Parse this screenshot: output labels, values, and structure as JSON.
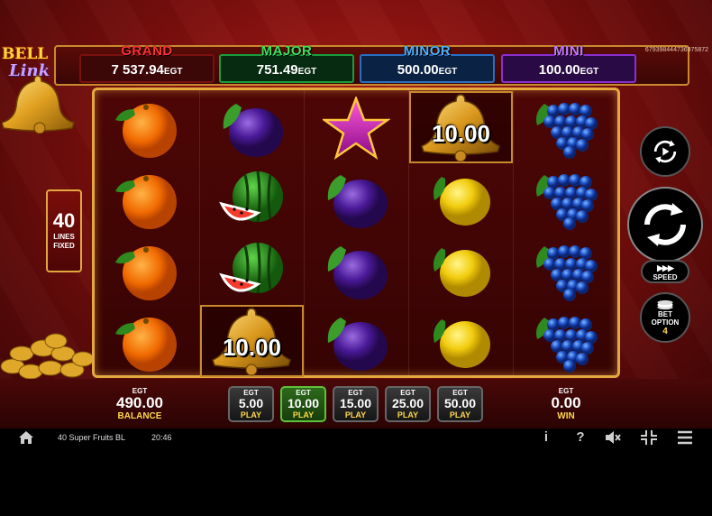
{
  "game": {
    "name": "40 Super Fruits BL",
    "time": "20:46"
  },
  "logo": {
    "line1": "BELL",
    "line2": "Link"
  },
  "jackpots": {
    "grand": {
      "label": "GRAND",
      "value": "7 537.94",
      "unit": "EGT"
    },
    "major": {
      "label": "MAJOR",
      "value": "751.49",
      "unit": "EGT"
    },
    "minor": {
      "label": "MINOR",
      "value": "500.00",
      "unit": "EGT"
    },
    "mini": {
      "label": "MINI",
      "value": "100.00",
      "unit": "EGT"
    },
    "id": "679398444736975872"
  },
  "lines": {
    "count": "40",
    "label1": "LINES",
    "label2": "FIXED"
  },
  "reels": [
    [
      "orange",
      "orange",
      "orange",
      "orange"
    ],
    [
      "plum",
      "watermelon",
      "watermelon",
      "bell"
    ],
    [
      "star",
      "plum",
      "plum",
      "plum"
    ],
    [
      "bell",
      "lemon",
      "lemon",
      "lemon"
    ],
    [
      "grapes",
      "grapes",
      "grapes",
      "grapes"
    ]
  ],
  "bell_values": {
    "r0c3": "10.00",
    "r3c1": "10.00"
  },
  "controls": {
    "speed": "SPEED",
    "bet_option": {
      "label1": "BET",
      "label2": "OPTION",
      "value": "4"
    }
  },
  "balance": {
    "unit": "EGT",
    "value": "490.00",
    "label": "BALANCE"
  },
  "win": {
    "unit": "EGT",
    "value": "0.00",
    "label": "WIN"
  },
  "bets": [
    {
      "unit": "EGT",
      "value": "5.00",
      "label": "PLAY"
    },
    {
      "unit": "EGT",
      "value": "10.00",
      "label": "PLAY"
    },
    {
      "unit": "EGT",
      "value": "15.00",
      "label": "PLAY"
    },
    {
      "unit": "EGT",
      "value": "25.00",
      "label": "PLAY"
    },
    {
      "unit": "EGT",
      "value": "50.00",
      "label": "PLAY"
    }
  ],
  "active_bet_index": 1,
  "os": {
    "info": "i",
    "help": "?"
  }
}
